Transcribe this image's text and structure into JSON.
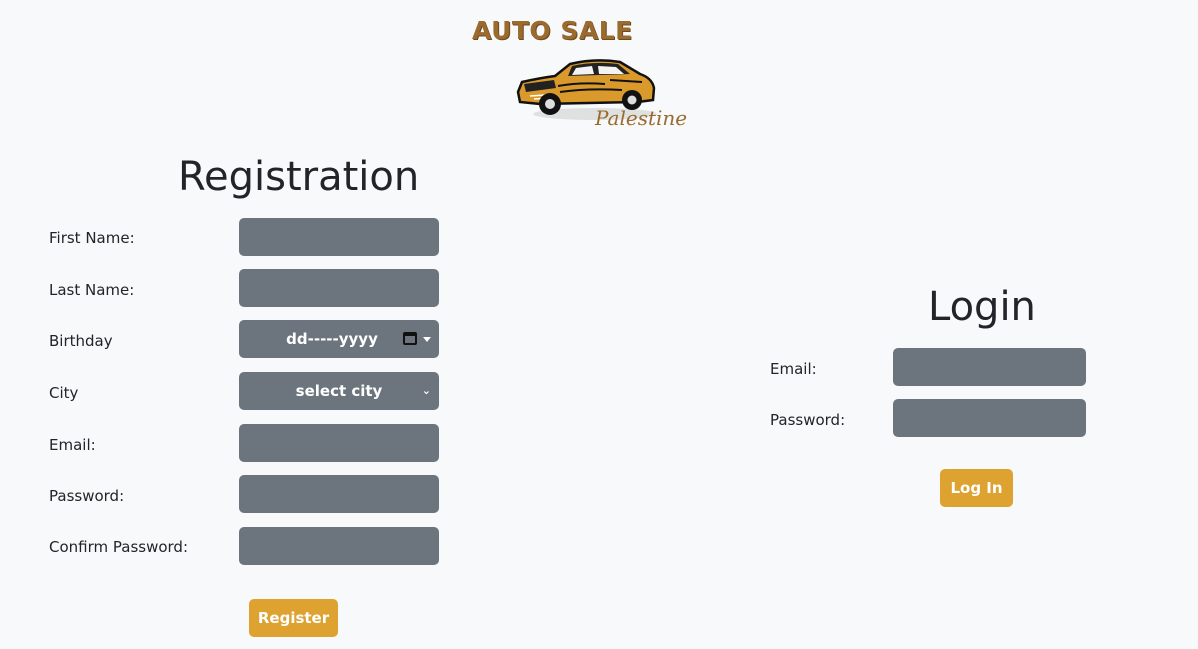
{
  "logo": {
    "title": "AUTO SALE",
    "subtitle": "Palestine",
    "icon": "car-icon"
  },
  "registration": {
    "title": "Registration",
    "fields": [
      {
        "label": "First Name:",
        "value": ""
      },
      {
        "label": "Last Name:",
        "value": ""
      },
      {
        "label": "Birthday",
        "value": "dd-----yyyy"
      },
      {
        "label": "City",
        "value": "select city"
      },
      {
        "label": "Email:",
        "value": ""
      },
      {
        "label": "Password:",
        "value": ""
      },
      {
        "label": "Confirm Password:",
        "value": ""
      }
    ],
    "submit_label": "Register"
  },
  "login": {
    "title": "Login",
    "fields": [
      {
        "label": "Email:",
        "value": ""
      },
      {
        "label": "Password:",
        "value": ""
      }
    ],
    "submit_label": "Log In"
  },
  "colors": {
    "background": "#f8f9fa",
    "input": "#6c757d",
    "accent": "#dda230",
    "brand": "#9a6a2e"
  }
}
